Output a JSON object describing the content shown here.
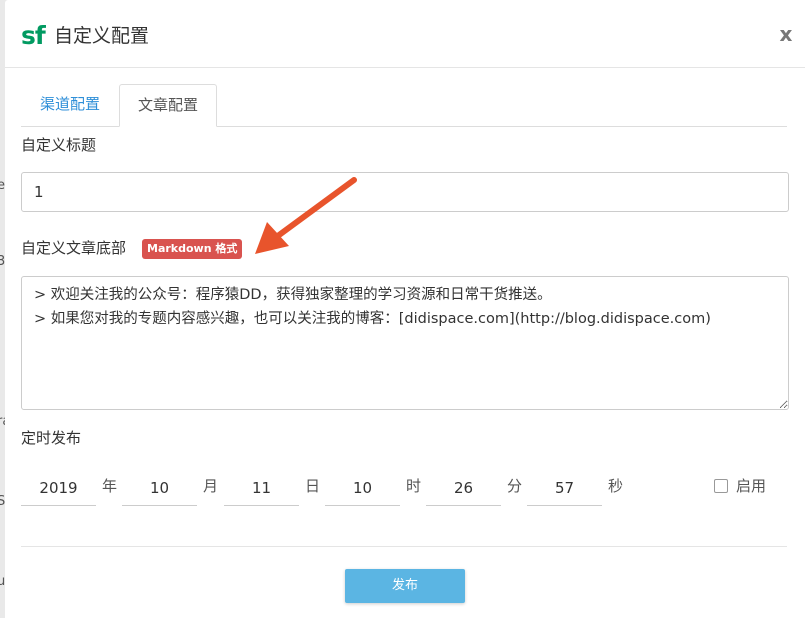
{
  "background": {
    "fragments": [
      "e",
      "3",
      "ra",
      "S",
      "u"
    ]
  },
  "dialog": {
    "logo_text": "sf",
    "title": "自定义配置",
    "close_label": "x"
  },
  "tabs": [
    {
      "label": "渠道配置",
      "active": false
    },
    {
      "label": "文章配置",
      "active": true
    }
  ],
  "form": {
    "custom_title": {
      "label": "自定义标题",
      "value": "1"
    },
    "article_footer": {
      "label": "自定义文章底部",
      "badge": "Markdown 格式",
      "value": "> 欢迎关注我的公众号：程序猿DD，获得独家整理的学习资源和日常干货推送。\n> 如果您对我的专题内容感兴趣，也可以关注我的博客：[didispace.com](http://blog.didispace.com)"
    },
    "schedule": {
      "label": "定时发布",
      "fields": [
        {
          "value": "2019",
          "unit": "年"
        },
        {
          "value": "10",
          "unit": "月"
        },
        {
          "value": "11",
          "unit": "日"
        },
        {
          "value": "10",
          "unit": "时"
        },
        {
          "value": "26",
          "unit": "分"
        },
        {
          "value": "57",
          "unit": "秒"
        }
      ],
      "enable_label": "启用",
      "enabled": false
    },
    "submit_label": "发布"
  },
  "colors": {
    "brand": "#019a61",
    "tab_link": "#2f8fd8",
    "badge": "#d9534f",
    "arrow": "#e8542c",
    "submit": "#5bb5e3"
  }
}
